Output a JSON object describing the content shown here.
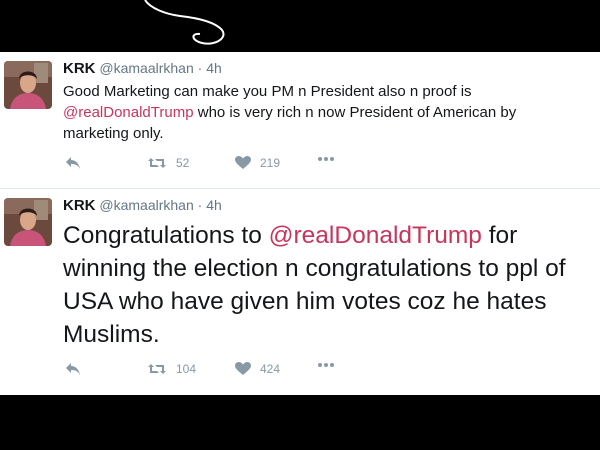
{
  "colors": {
    "background": "#000000",
    "card": "#ffffff",
    "mention": "#c8355c",
    "meta": "#8899a6"
  },
  "tweets": [
    {
      "name": "KRK",
      "handle": "@kamaalrkhan",
      "dot": "·",
      "time": "4h",
      "text_before": "Good Marketing can make you PM n President also n proof is ",
      "mention": "@realDonaldTrump",
      "text_after": " who is very rich n now President of American by marketing only.",
      "retweets": "52",
      "likes": "219"
    },
    {
      "name": "KRK",
      "handle": "@kamaalrkhan",
      "dot": "·",
      "time": "4h",
      "text_before": "Congratulations to ",
      "mention": "@realDonaldTrump",
      "text_after": " for winning the election n congratulations to ppl of USA who have given him votes coz he hates Muslims.",
      "retweets": "104",
      "likes": "424"
    }
  ],
  "icons": {
    "reply": "reply-icon",
    "retweet": "retweet-icon",
    "like": "heart-icon",
    "more": "more-icon"
  }
}
